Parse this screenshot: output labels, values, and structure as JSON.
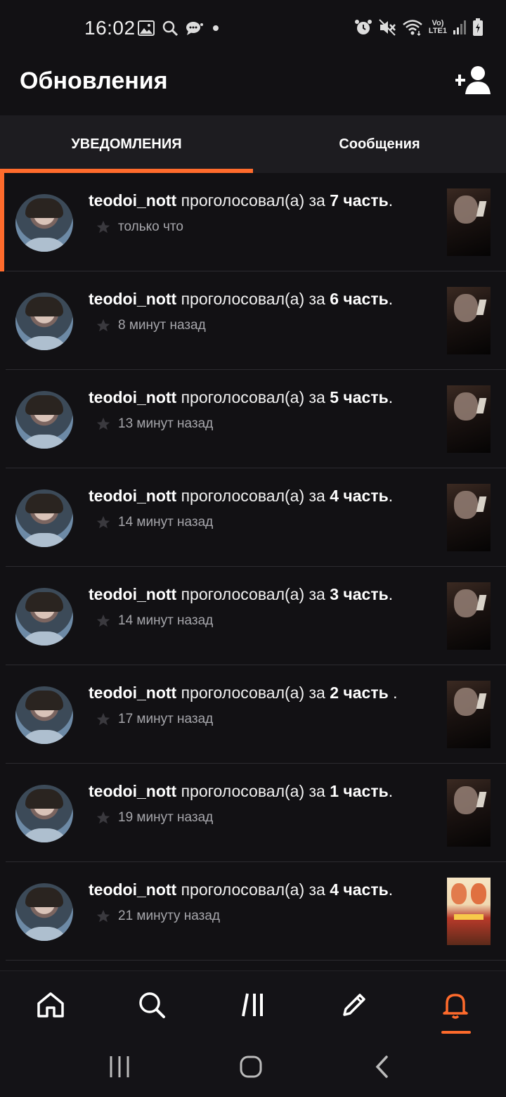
{
  "status_bar": {
    "time": "16:02",
    "left_icons": [
      "image-icon",
      "search-icon",
      "chat-icon",
      "dot-icon"
    ],
    "right_icons": [
      "alarm-icon",
      "mute-icon",
      "wifi-icon",
      "volte-icon",
      "signal-icon",
      "battery-icon"
    ],
    "network_label_1": "Vo)",
    "network_label_2": "LTE1"
  },
  "header": {
    "title": "Обновления",
    "add_icon": "add-user-icon"
  },
  "tabs": [
    {
      "label": "УВЕДОМЛЕНИЯ",
      "active": true
    },
    {
      "label": "Сообщения",
      "active": false
    }
  ],
  "notifications": [
    {
      "user": "teodoi_nott",
      "verb": "проголосовал(а) за",
      "part": "7 часть",
      "suffix": ".",
      "time": "только что",
      "unread": true
    },
    {
      "user": "teodoi_nott",
      "verb": "проголосовал(а) за",
      "part": "6 часть",
      "suffix": ".",
      "time": "8 минут назад",
      "unread": false
    },
    {
      "user": "teodoi_nott",
      "verb": "проголосовал(а) за",
      "part": "5 часть",
      "suffix": ".",
      "time": "13 минут назад",
      "unread": false
    },
    {
      "user": "teodoi_nott",
      "verb": "проголосовал(а) за",
      "part": "4 часть",
      "suffix": ".",
      "time": "14 минут назад",
      "unread": false
    },
    {
      "user": "teodoi_nott",
      "verb": "проголосовал(а) за",
      "part": "3 часть",
      "suffix": ".",
      "time": "14 минут назад",
      "unread": false
    },
    {
      "user": "teodoi_nott",
      "verb": "проголосовал(а) за",
      "part": "2 часть",
      "suffix": " .",
      "time": "17 минут назад",
      "unread": false
    },
    {
      "user": "teodoi_nott",
      "verb": "проголосовал(а) за",
      "part": "1 часть",
      "suffix": ".",
      "time": "19 минут назад",
      "unread": false
    },
    {
      "user": "teodoi_nott",
      "verb": "проголосовал(а) за",
      "part": "4 часть",
      "suffix": ".",
      "time": "21 минуту назад",
      "unread": false
    }
  ],
  "bottom_nav": {
    "items": [
      "home-icon",
      "search-icon",
      "library-icon",
      "write-icon",
      "notifications-bell-icon"
    ],
    "active": "notifications-bell-icon"
  },
  "system_nav": [
    "recents-icon",
    "home-circle-icon",
    "back-icon"
  ],
  "colors": {
    "accent": "#ff6b2c",
    "background": "#121114",
    "tab_bar": "#1d1c20",
    "secondary_text": "#a6a6ab"
  }
}
